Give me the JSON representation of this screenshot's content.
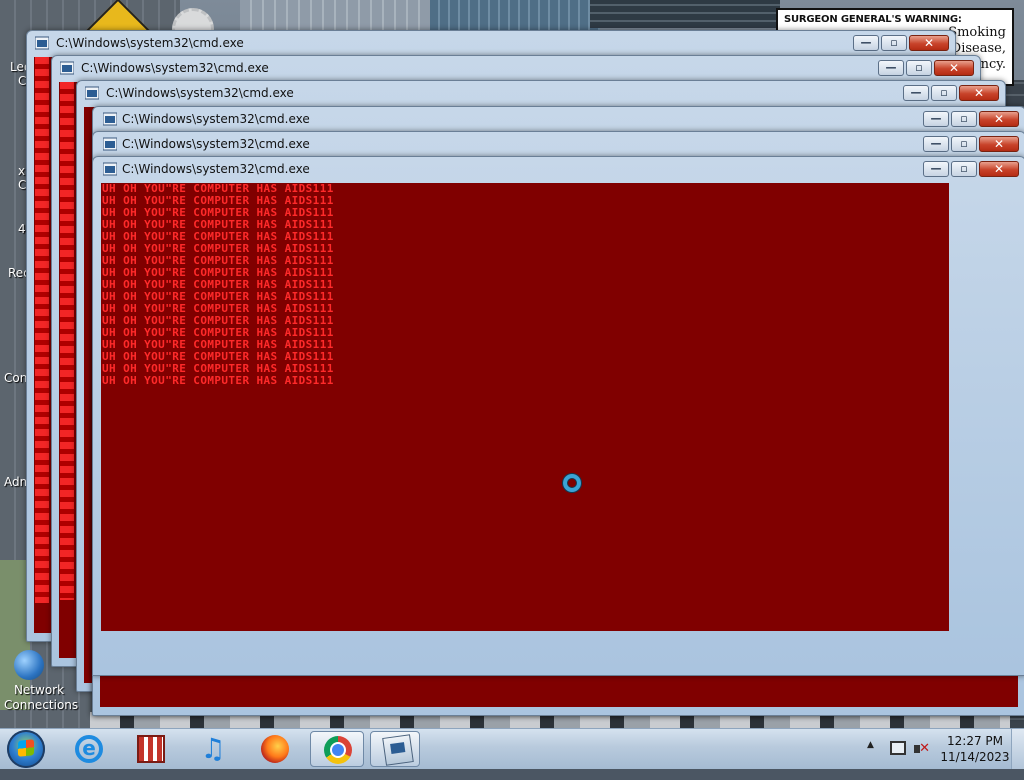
{
  "desktop": {
    "billboard": {
      "heading": "SURGEON GENERAL'S WARNING:",
      "lines": [
        "Smoking",
        "Disease,",
        "ncy."
      ]
    },
    "side_labels": [
      "Lee",
      "C",
      "x",
      "C",
      "4",
      "Rec",
      "Con",
      "Adm"
    ],
    "network_icon_label_1": "Network",
    "network_icon_label_2": "Connections"
  },
  "windows": [
    {
      "title": "C:\\Windows\\system32\\cmd.exe",
      "min": "—",
      "max": "▫",
      "close": "✕"
    },
    {
      "title": "C:\\Windows\\system32\\cmd.exe",
      "min": "—",
      "max": "▫",
      "close": "✕"
    },
    {
      "title": "C:\\Windows\\system32\\cmd.exe",
      "min": "—",
      "max": "▫",
      "close": "✕"
    },
    {
      "title": "C:\\Windows\\system32\\cmd.exe",
      "min": "—",
      "max": "▫",
      "close": "✕"
    },
    {
      "title": "C:\\Windows\\system32\\cmd.exe",
      "min": "—",
      "max": "▫",
      "close": "✕"
    },
    {
      "title": "C:\\Windows\\system32\\cmd.exe",
      "min": "—",
      "max": "▫",
      "close": "✕"
    }
  ],
  "console": {
    "text_color": "#ff2a2a",
    "background_color": "#800000",
    "lines": [
      "UH OH YOU\"RE COMPUTER HAS AIDS111",
      "UH OH YOU\"RE COMPUTER HAS AIDS111",
      "UH OH YOU\"RE COMPUTER HAS AIDS111",
      "UH OH YOU\"RE COMPUTER HAS AIDS111",
      "UH OH YOU\"RE COMPUTER HAS AIDS111",
      "UH OH YOU\"RE COMPUTER HAS AIDS111",
      "UH OH YOU\"RE COMPUTER HAS AIDS111",
      "UH OH YOU\"RE COMPUTER HAS AIDS111",
      "UH OH YOU\"RE COMPUTER HAS AIDS111",
      "UH OH YOU\"RE COMPUTER HAS AIDS111",
      "UH OH YOU\"RE COMPUTER HAS AIDS111",
      "UH OH YOU\"RE COMPUTER HAS AIDS111",
      "UH OH YOU\"RE COMPUTER HAS AIDS111",
      "UH OH YOU\"RE COMPUTER HAS AIDS111",
      "UH OH YOU\"RE COMPUTER HAS AIDS111",
      "UH OH YOU\"RE COMPUTER HAS AIDS111",
      "UH OH YOU\"RE COMPUTER HAS AIDS111"
    ]
  },
  "taskbar": {
    "pinned": [
      {
        "name": "internet-explorer",
        "icon": "ie-icon",
        "active": false
      },
      {
        "name": "store",
        "icon": "store-icon",
        "active": false
      },
      {
        "name": "itunes",
        "icon": "music-note-icon",
        "active": false
      },
      {
        "name": "firefox",
        "icon": "firefox-icon",
        "active": false
      },
      {
        "name": "chrome",
        "icon": "chrome-icon",
        "active": true
      },
      {
        "name": "cmd",
        "icon": "cmd-icon",
        "active": true
      }
    ],
    "clock": {
      "time": "12:27 PM",
      "date": "11/14/2023"
    },
    "tray_arrow": "▲",
    "volume_mute_glyph": "✕"
  }
}
